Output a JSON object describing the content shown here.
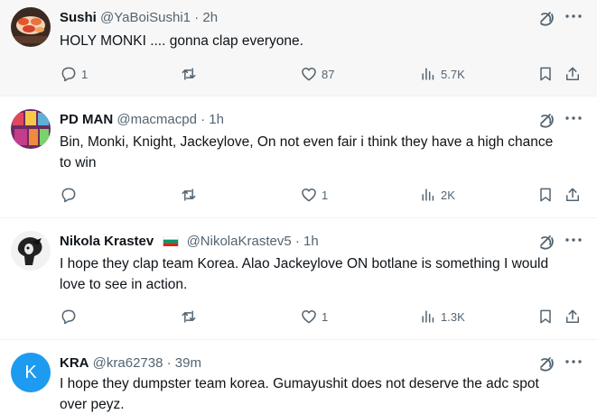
{
  "tweets": [
    {
      "name": "Sushi",
      "handle": "@YaBoiSushi1",
      "time": "2h",
      "text": "HOLY MONKI .... gonna clap everyone.",
      "replies": "1",
      "retweets": "",
      "likes": "87",
      "views": "5.7K"
    },
    {
      "name": "PD MAN",
      "handle": "@macmacpd",
      "time": "1h",
      "text": "Bin, Monki, Knight, Jackeylove, On not even fair i think they have a high chance to win",
      "replies": "",
      "retweets": "",
      "likes": "1",
      "views": "2K"
    },
    {
      "name": "Nikola Krastev",
      "handle": "@NikolaKrastev5",
      "time": "1h",
      "text": "I hope they clap team Korea. Alao Jackeylove ON botlane is something I would love to see in action.",
      "replies": "",
      "retweets": "",
      "likes": "1",
      "views": "1.3K"
    },
    {
      "name": "KRA",
      "handle": "@kra62738",
      "time": "39m",
      "text": "I hope they dumpster team korea. Gumayushit does not deserve the adc spot over peyz.",
      "avatar_letter": "K",
      "avatar_color": "#1d9bf0"
    }
  ],
  "separator": "·",
  "colors": {
    "secondary": "#536471",
    "hover_bg": "#f7f7f7",
    "divider": "#eff3f4"
  }
}
